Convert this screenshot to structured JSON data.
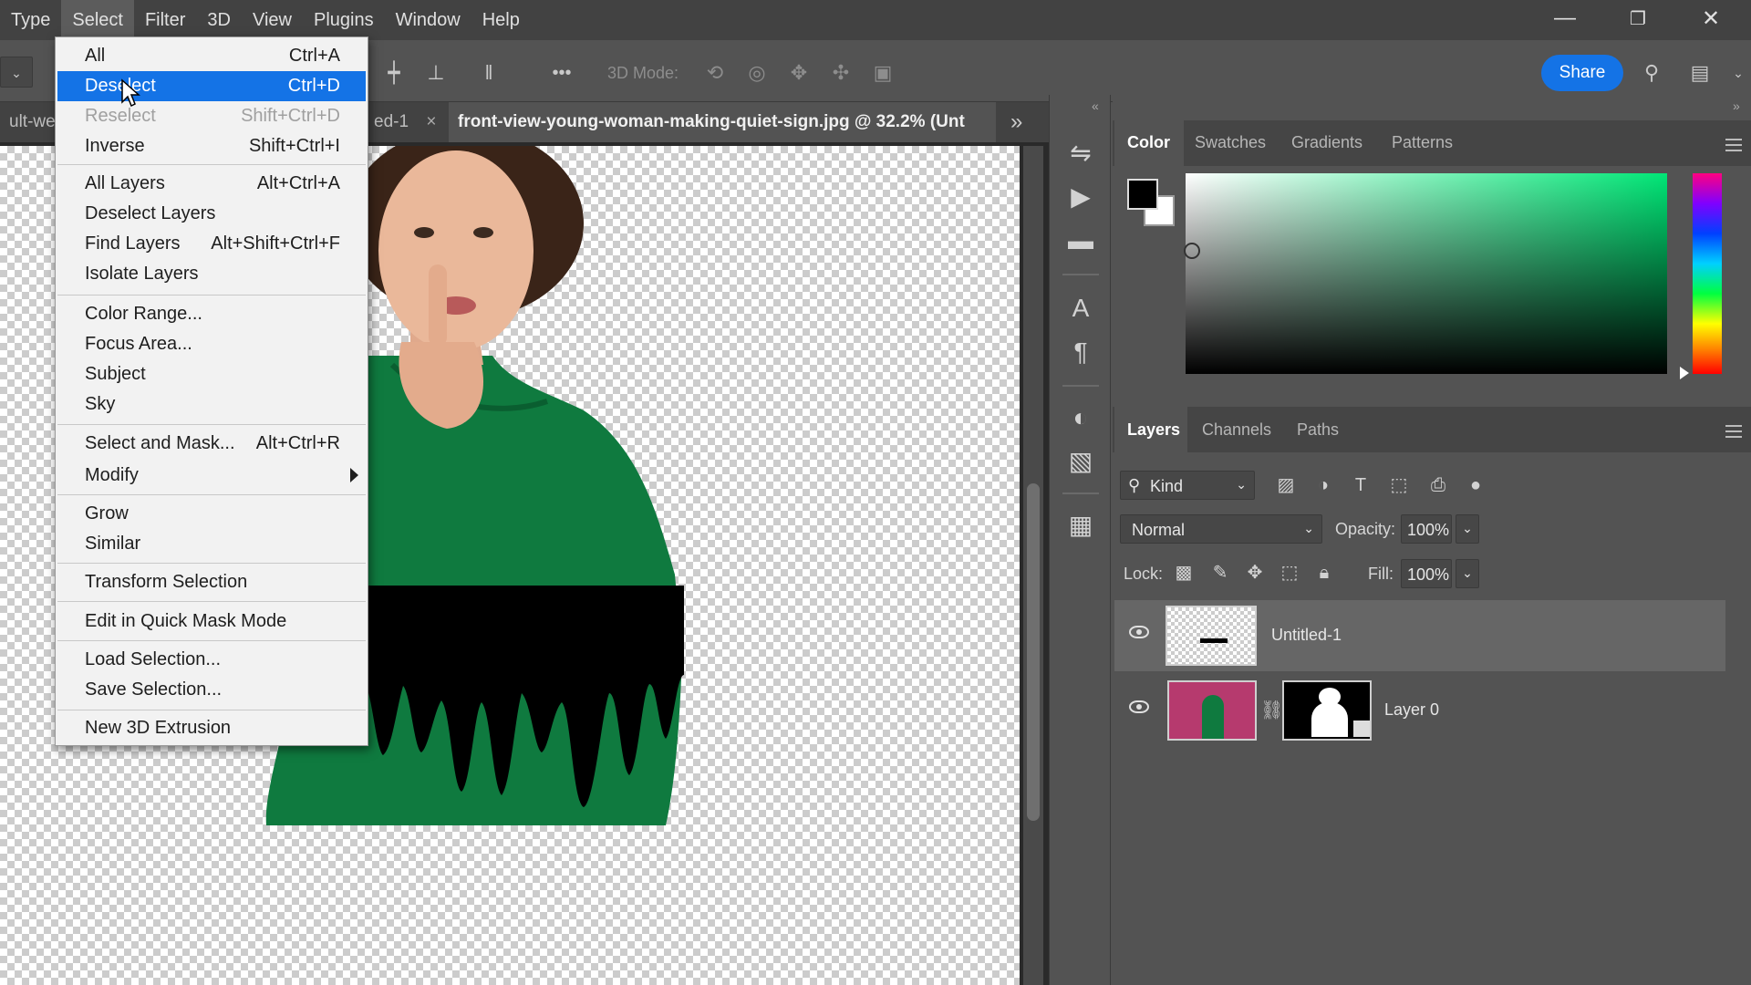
{
  "menubar": {
    "items": [
      "Type",
      "Select",
      "Filter",
      "3D",
      "View",
      "Plugins",
      "Window",
      "Help"
    ],
    "active": "Select"
  },
  "window_controls": {
    "minimize": "—",
    "restore": "❐",
    "close": "✕"
  },
  "options_bar": {
    "mode_label": "3D Mode:",
    "share_label": "Share",
    "more": "•••"
  },
  "tabs": [
    {
      "label": "ult-we"
    },
    {
      "label": "ed-1",
      "close": "×"
    },
    {
      "label": "front-view-young-woman-making-quiet-sign.jpg @ 32.2% (Unt"
    }
  ],
  "tab_overflow": "»",
  "select_menu": {
    "items": [
      {
        "label": "All",
        "shortcut": "Ctrl+A"
      },
      {
        "label": "Deselect",
        "shortcut": "Ctrl+D",
        "highlighted": true
      },
      {
        "label": "Reselect",
        "shortcut": "Shift+Ctrl+D",
        "disabled": true
      },
      {
        "label": "Inverse",
        "shortcut": "Shift+Ctrl+I"
      },
      {
        "label": "All Layers",
        "shortcut": "Alt+Ctrl+A"
      },
      {
        "label": "Deselect Layers",
        "shortcut": ""
      },
      {
        "label": "Find Layers",
        "shortcut": "Alt+Shift+Ctrl+F"
      },
      {
        "label": "Isolate Layers",
        "shortcut": ""
      },
      {
        "label": "Color Range...",
        "shortcut": ""
      },
      {
        "label": "Focus Area...",
        "shortcut": ""
      },
      {
        "label": "Subject",
        "shortcut": ""
      },
      {
        "label": "Sky",
        "shortcut": ""
      },
      {
        "label": "Select and Mask...",
        "shortcut": "Alt+Ctrl+R"
      },
      {
        "label": "Modify",
        "shortcut": ""
      },
      {
        "label": "Grow",
        "shortcut": ""
      },
      {
        "label": "Similar",
        "shortcut": ""
      },
      {
        "label": "Transform Selection",
        "shortcut": ""
      },
      {
        "label": "Edit in Quick Mask Mode",
        "shortcut": ""
      },
      {
        "label": "Load Selection...",
        "shortcut": ""
      },
      {
        "label": "Save Selection...",
        "shortcut": ""
      },
      {
        "label": "New 3D Extrusion",
        "shortcut": ""
      }
    ]
  },
  "color_panel": {
    "tabs": [
      "Color",
      "Swatches",
      "Gradients",
      "Patterns"
    ],
    "active_tab": "Color",
    "foreground": "#000000",
    "background": "#ffffff"
  },
  "layers_panel": {
    "tabs": [
      "Layers",
      "Channels",
      "Paths"
    ],
    "active_tab": "Layers",
    "filter_kind": "Kind",
    "blend_mode": "Normal",
    "opacity_label": "Opacity:",
    "opacity_value": "100%",
    "lock_label": "Lock:",
    "fill_label": "Fill:",
    "fill_value": "100%",
    "layers": [
      {
        "name": "Untitled-1",
        "selected": true,
        "visible": true
      },
      {
        "name": "Layer 0",
        "selected": false,
        "visible": true,
        "has_mask": true
      }
    ]
  },
  "colors": {
    "accent": "#1473e6",
    "menubar": "#424242",
    "panel": "#535353",
    "hoodie": "#0f7a3f"
  }
}
